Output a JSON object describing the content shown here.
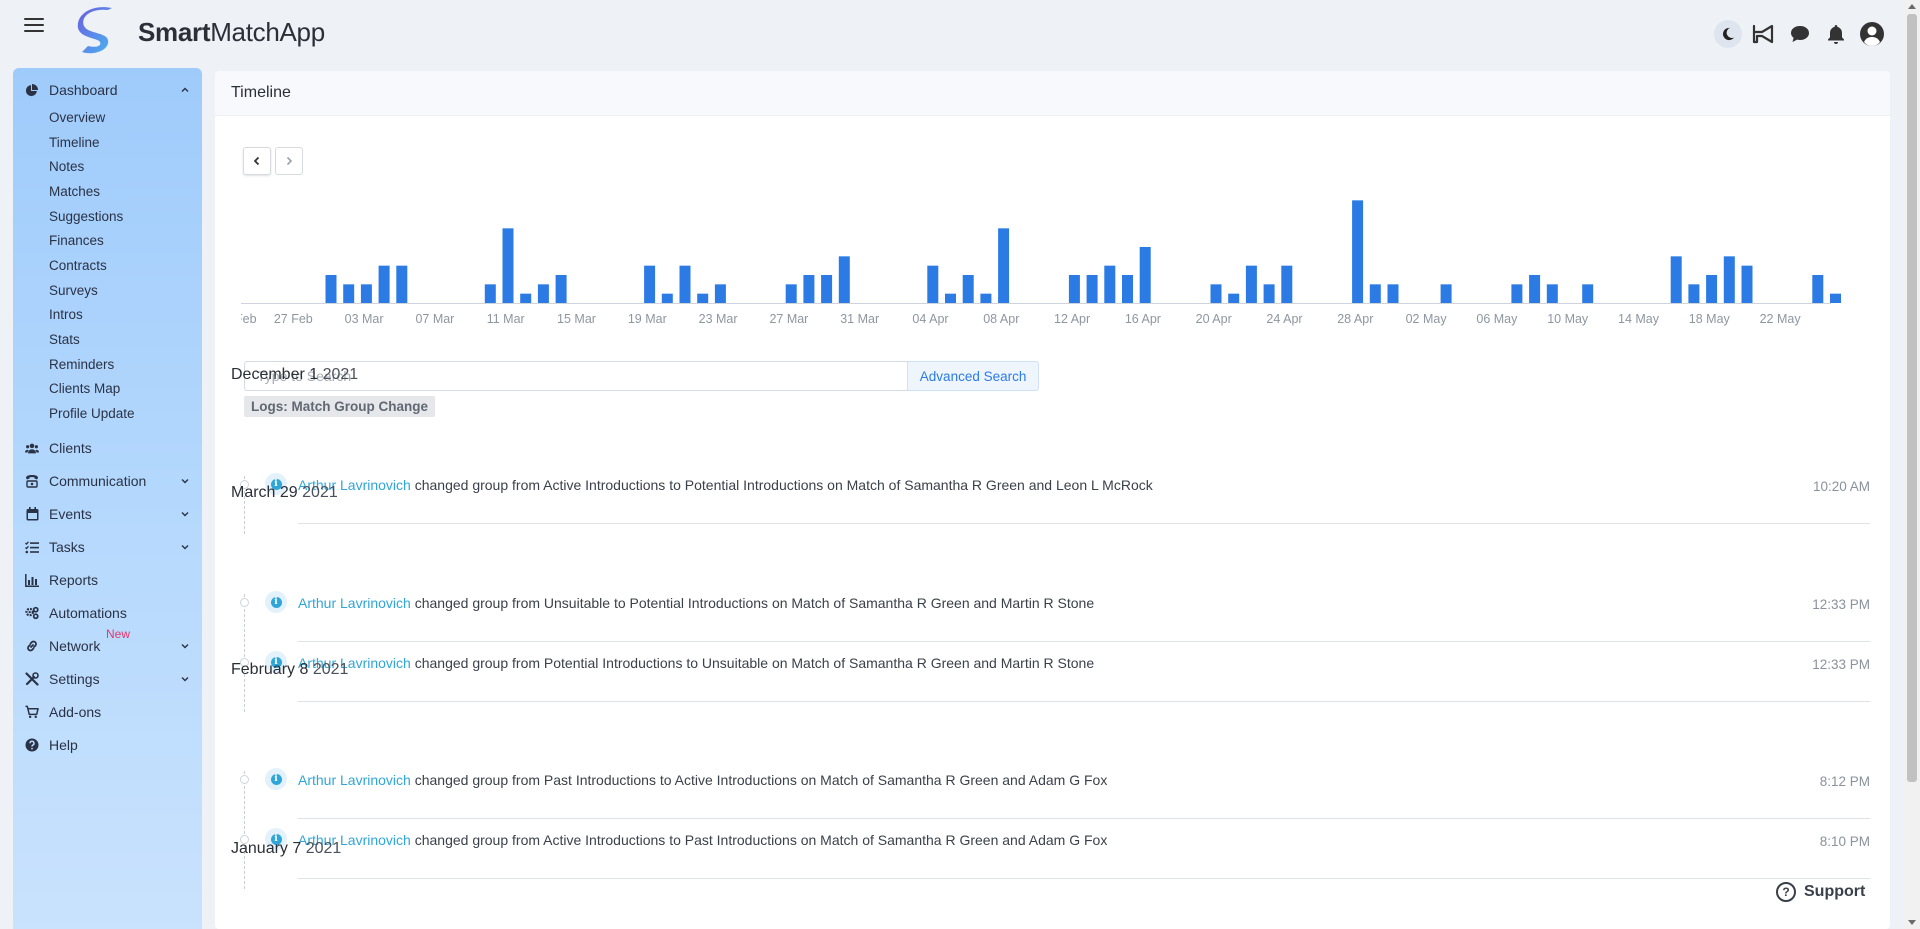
{
  "app": {
    "brand_bold": "Smart",
    "brand_rest": "MatchApp"
  },
  "header": {
    "icons": [
      "menu-icon",
      "moon-icon",
      "megaphone-icon",
      "chat-icon",
      "bell-icon",
      "user-circle-icon"
    ]
  },
  "sidebar": {
    "dashboard": {
      "label": "Dashboard",
      "sub": [
        "Overview",
        "Timeline",
        "Notes",
        "Matches",
        "Suggestions",
        "Finances",
        "Contracts",
        "Surveys",
        "Intros",
        "Stats",
        "Reminders",
        "Clients Map",
        "Profile Update"
      ]
    },
    "items": [
      {
        "label": "Clients"
      },
      {
        "label": "Communication"
      },
      {
        "label": "Events"
      },
      {
        "label": "Tasks"
      },
      {
        "label": "Reports"
      },
      {
        "label": "Automations"
      },
      {
        "label": "Network",
        "badge": "New"
      },
      {
        "label": "Settings"
      },
      {
        "label": "Add-ons"
      },
      {
        "label": "Help"
      }
    ]
  },
  "main": {
    "title": "Timeline",
    "search_placeholder": "Type to Search",
    "advanced_search": "Advanced Search",
    "filter_chip": "Logs: Match Group Change",
    "groups": [
      {
        "day": "December 1",
        "year": "2021",
        "entries": [
          {
            "user": "Arthur Lavrinovich",
            "text": "changed group from Active Introductions to Potential Introductions on Match of Samantha R Green and Leon L McRock",
            "time": "10:20 AM"
          }
        ]
      },
      {
        "day": "March 29",
        "year": "2021",
        "entries": [
          {
            "user": "Arthur Lavrinovich",
            "text": "changed group from Unsuitable to Potential Introductions on Match of Samantha R Green and Martin R Stone",
            "time": "12:33 PM"
          },
          {
            "user": "Arthur Lavrinovich",
            "text": "changed group from Potential Introductions to Unsuitable on Match of Samantha R Green and Martin R Stone",
            "time": "12:33 PM"
          }
        ]
      },
      {
        "day": "February 8",
        "year": "2021",
        "entries": [
          {
            "user": "Arthur Lavrinovich",
            "text": "changed group from Past Introductions to Active Introductions on Match of Samantha R Green and Adam G Fox",
            "time": "8:12 PM"
          },
          {
            "user": "Arthur Lavrinovich",
            "text": "changed group from Active Introductions to Past Introductions on Match of Samantha R Green and Adam G Fox",
            "time": "8:10 PM"
          }
        ]
      },
      {
        "day": "January 7",
        "year": "2021",
        "entries": []
      }
    ]
  },
  "support": {
    "label": "Support"
  },
  "colors": {
    "accent": "#2c7be5",
    "bar": "#2c7be5",
    "link": "#2fa6d9",
    "new_badge": "#e8356c"
  },
  "chart_data": {
    "type": "bar",
    "x_ticks": [
      "Feb",
      "27 Feb",
      "03 Mar",
      "07 Mar",
      "11 Mar",
      "15 Mar",
      "19 Mar",
      "23 Mar",
      "27 Mar",
      "31 Mar",
      "04 Apr",
      "08 Apr",
      "12 Apr",
      "16 Apr",
      "20 Apr",
      "24 Apr",
      "28 Apr",
      "02 May",
      "06 May",
      "10 May",
      "14 May",
      "18 May",
      "22 May"
    ],
    "values": [
      3,
      0,
      0,
      0,
      0,
      3,
      2,
      2,
      4,
      4,
      0,
      0,
      0,
      0,
      2,
      8,
      1,
      2,
      3,
      0,
      0,
      0,
      0,
      4,
      1,
      4,
      1,
      2,
      0,
      0,
      0,
      2,
      3,
      3,
      5,
      0,
      0,
      0,
      0,
      4,
      1,
      3,
      1,
      8,
      0,
      0,
      0,
      3,
      3,
      4,
      3,
      6,
      0,
      0,
      0,
      2,
      1,
      4,
      2,
      4,
      0,
      0,
      0,
      11,
      2,
      2,
      0,
      0,
      2,
      0,
      0,
      0,
      2,
      3,
      2,
      0,
      2,
      0,
      0,
      0,
      0,
      5,
      2,
      3,
      5,
      4,
      0,
      0,
      0,
      3,
      1,
      5,
      2,
      4,
      0,
      0,
      0,
      5,
      2,
      3,
      1,
      2,
      0,
      0,
      0,
      2,
      4
    ],
    "bars_per_tick": 4,
    "ylim": [
      0,
      12
    ]
  }
}
